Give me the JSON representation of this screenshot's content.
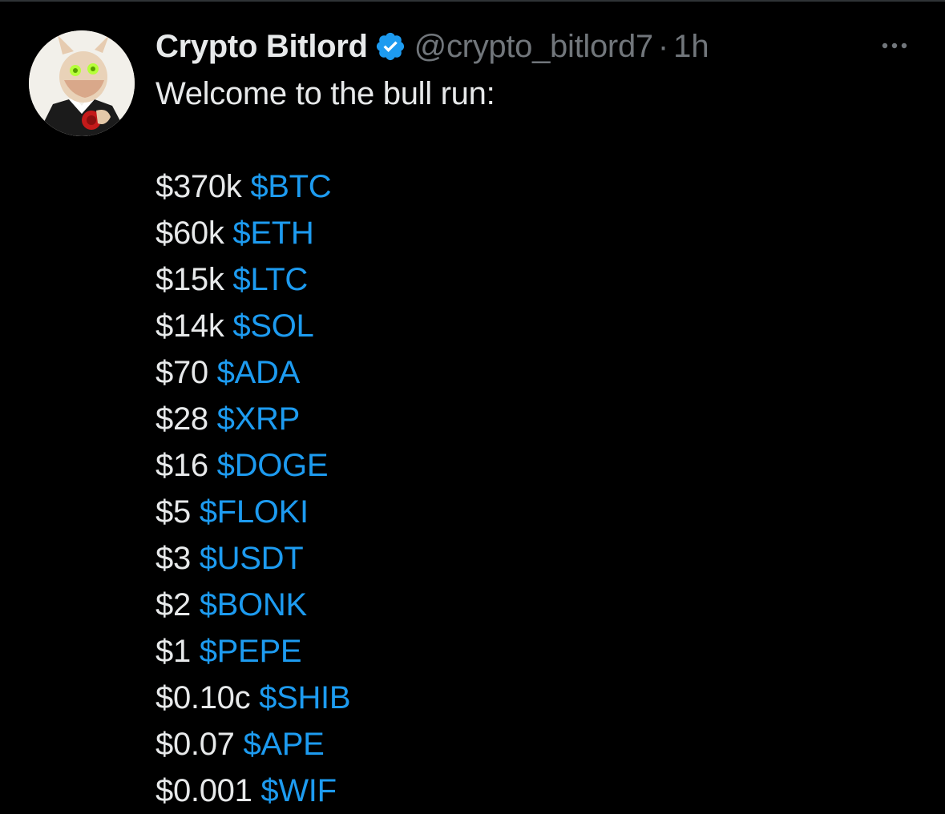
{
  "tweet": {
    "display_name": "Crypto Bitlord",
    "handle": "@crypto_bitlord7",
    "separator": "·",
    "time": "1h",
    "verified_icon": "verified-badge-icon",
    "more_icon": "more-options-icon",
    "intro": "Welcome to the bull run:",
    "lines": [
      {
        "price": "$370k",
        "ticker": "$BTC"
      },
      {
        "price": "$60k",
        "ticker": "$ETH"
      },
      {
        "price": "$15k",
        "ticker": "$LTC"
      },
      {
        "price": "$14k",
        "ticker": "$SOL"
      },
      {
        "price": "$70",
        "ticker": "$ADA"
      },
      {
        "price": "$28",
        "ticker": "$XRP"
      },
      {
        "price": "$16",
        "ticker": "$DOGE"
      },
      {
        "price": "$5",
        "ticker": "$FLOKI"
      },
      {
        "price": "$3",
        "ticker": "$USDT"
      },
      {
        "price": "$2",
        "ticker": "$BONK"
      },
      {
        "price": "$1",
        "ticker": "$PEPE"
      },
      {
        "price": "$0.10c",
        "ticker": "$SHIB"
      },
      {
        "price": "$0.07",
        "ticker": "$APE"
      },
      {
        "price": "$0.001",
        "ticker": "$WIF"
      }
    ]
  },
  "colors": {
    "background": "#000000",
    "text": "#e7e9ea",
    "muted": "#71767b",
    "link": "#1d9bf0",
    "verified": "#1d9bf0"
  }
}
